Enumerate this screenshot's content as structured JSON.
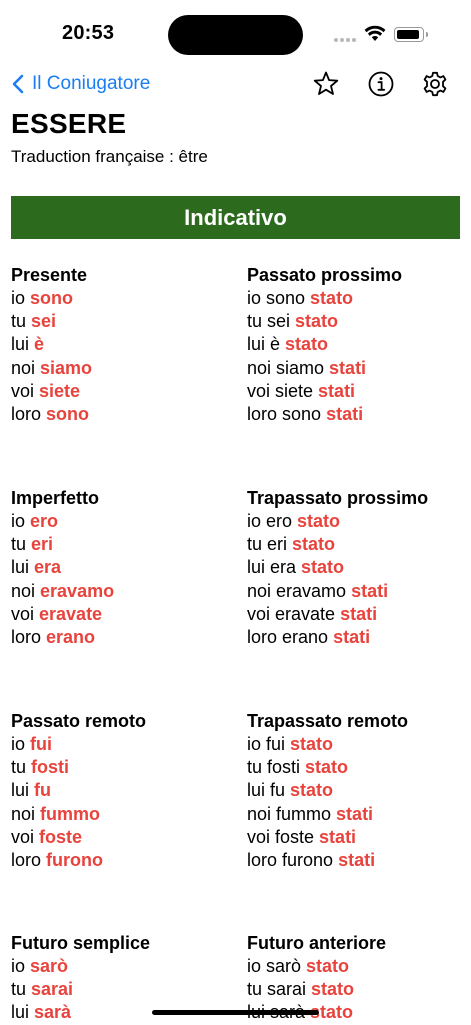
{
  "status": {
    "time": "20:53"
  },
  "nav": {
    "back_label": "Il Coniugatore"
  },
  "verb": {
    "title": "ESSERE",
    "translation": "Traduction française : être"
  },
  "section": {
    "title": "Indicativo"
  },
  "tenses": [
    {
      "name": "Presente",
      "lines": [
        {
          "pre": "io ",
          "form": "sono"
        },
        {
          "pre": "tu ",
          "form": "sei"
        },
        {
          "pre": "lui ",
          "form": "è"
        },
        {
          "pre": "noi ",
          "form": "siamo"
        },
        {
          "pre": "voi ",
          "form": "siete"
        },
        {
          "pre": "loro ",
          "form": "sono"
        }
      ]
    },
    {
      "name": "Passato prossimo",
      "lines": [
        {
          "pre": "io sono ",
          "form": "stato"
        },
        {
          "pre": "tu sei ",
          "form": "stato"
        },
        {
          "pre": "lui è ",
          "form": "stato"
        },
        {
          "pre": "noi siamo ",
          "form": "stati"
        },
        {
          "pre": "voi siete ",
          "form": "stati"
        },
        {
          "pre": "loro sono ",
          "form": "stati"
        }
      ]
    },
    {
      "name": "Imperfetto",
      "lines": [
        {
          "pre": "io ",
          "form": "ero"
        },
        {
          "pre": "tu ",
          "form": "eri"
        },
        {
          "pre": "lui ",
          "form": "era"
        },
        {
          "pre": "noi ",
          "form": "eravamo"
        },
        {
          "pre": "voi ",
          "form": "eravate"
        },
        {
          "pre": "loro ",
          "form": "erano"
        }
      ]
    },
    {
      "name": "Trapassato prossimo",
      "lines": [
        {
          "pre": "io ero ",
          "form": "stato"
        },
        {
          "pre": "tu eri ",
          "form": "stato"
        },
        {
          "pre": "lui era ",
          "form": "stato"
        },
        {
          "pre": "noi eravamo ",
          "form": "stati"
        },
        {
          "pre": "voi eravate ",
          "form": "stati"
        },
        {
          "pre": "loro erano ",
          "form": "stati"
        }
      ]
    },
    {
      "name": "Passato remoto",
      "lines": [
        {
          "pre": "io ",
          "form": "fui"
        },
        {
          "pre": "tu ",
          "form": "fosti"
        },
        {
          "pre": "lui ",
          "form": "fu"
        },
        {
          "pre": "noi ",
          "form": "fummo"
        },
        {
          "pre": "voi ",
          "form": "foste"
        },
        {
          "pre": "loro ",
          "form": "furono"
        }
      ]
    },
    {
      "name": "Trapassato remoto",
      "lines": [
        {
          "pre": "io fui ",
          "form": "stato"
        },
        {
          "pre": "tu fosti ",
          "form": "stato"
        },
        {
          "pre": "lui fu ",
          "form": "stato"
        },
        {
          "pre": "noi fummo ",
          "form": "stati"
        },
        {
          "pre": "voi foste ",
          "form": "stati"
        },
        {
          "pre": "loro furono ",
          "form": "stati"
        }
      ]
    },
    {
      "name": "Futuro semplice",
      "lines": [
        {
          "pre": "io ",
          "form": "sarò"
        },
        {
          "pre": "tu ",
          "form": "sarai"
        },
        {
          "pre": "lui ",
          "form": "sarà"
        }
      ]
    },
    {
      "name": "Futuro anteriore",
      "lines": [
        {
          "pre": "io sarò ",
          "form": "stato"
        },
        {
          "pre": "tu sarai ",
          "form": "stato"
        },
        {
          "pre": "lui sarà ",
          "form": "stato"
        }
      ]
    }
  ],
  "icons": {
    "back": "chevron-left-icon",
    "favorite": "star-outline-icon",
    "info": "info-circle-icon",
    "settings": "gear-icon"
  },
  "colors": {
    "accent": "#1a7ef2",
    "section_header": "#2c6b1e",
    "conjugated_form": "#e8433d"
  }
}
